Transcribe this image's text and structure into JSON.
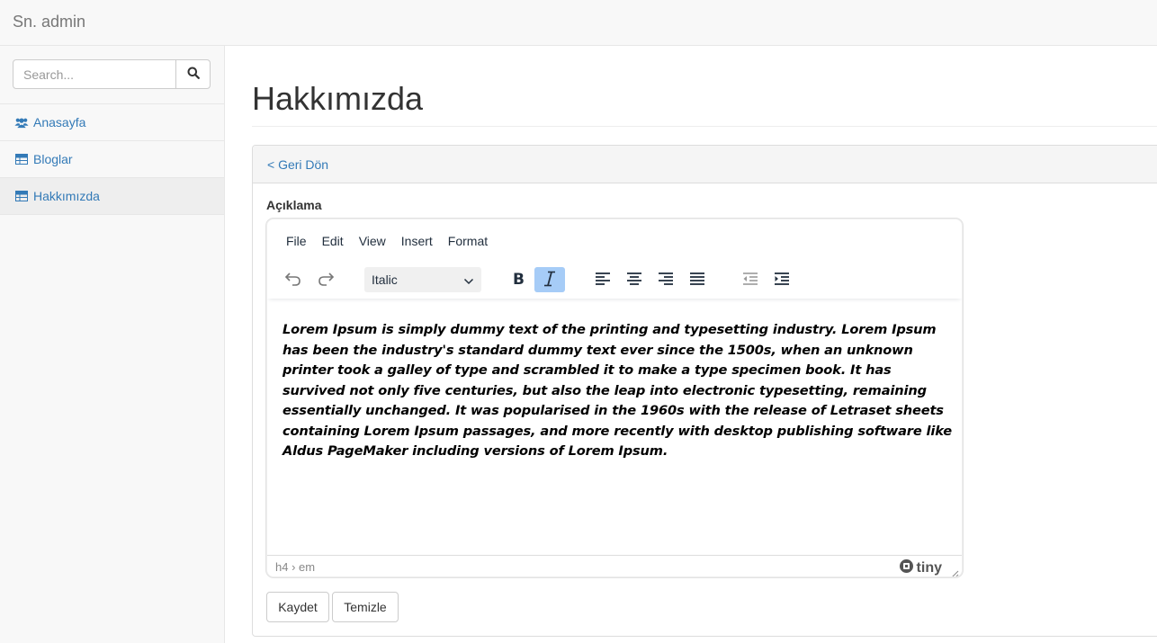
{
  "app": {
    "brand": "Sn. admin"
  },
  "sidebar": {
    "search_placeholder": "Search...",
    "items": [
      {
        "label": "Anasayfa",
        "icon": "users-icon"
      },
      {
        "label": "Bloglar",
        "icon": "table-icon"
      },
      {
        "label": "Hakkımızda",
        "icon": "table-icon",
        "active": true
      }
    ]
  },
  "page": {
    "title": "Hakkımızda",
    "back_label": "< Geri Dön",
    "field_label": "Açıklama"
  },
  "editor": {
    "menu": [
      "File",
      "Edit",
      "View",
      "Insert",
      "Format"
    ],
    "format_value": "Italic",
    "active_tool": "italic",
    "content": "Lorem Ipsum is simply dummy text of the printing and typesetting industry. Lorem Ipsum has been the industry's standard dummy text ever since the 1500s, when an unknown printer took a galley of type and scrambled it to make a type specimen book. It has survived not only five centuries, but also the leap into electronic typesetting, remaining essentially unchanged. It was popularised in the 1960s with the release of Letraset sheets containing Lorem Ipsum passages, and more recently with desktop publishing software like Aldus PageMaker including versions of Lorem Ipsum.",
    "path": "h4 › em",
    "brand": "tiny"
  },
  "actions": {
    "save_label": "Kaydet",
    "clear_label": "Temizle"
  },
  "colors": {
    "link": "#337ab7",
    "active_tool": "#a6ccf7"
  }
}
